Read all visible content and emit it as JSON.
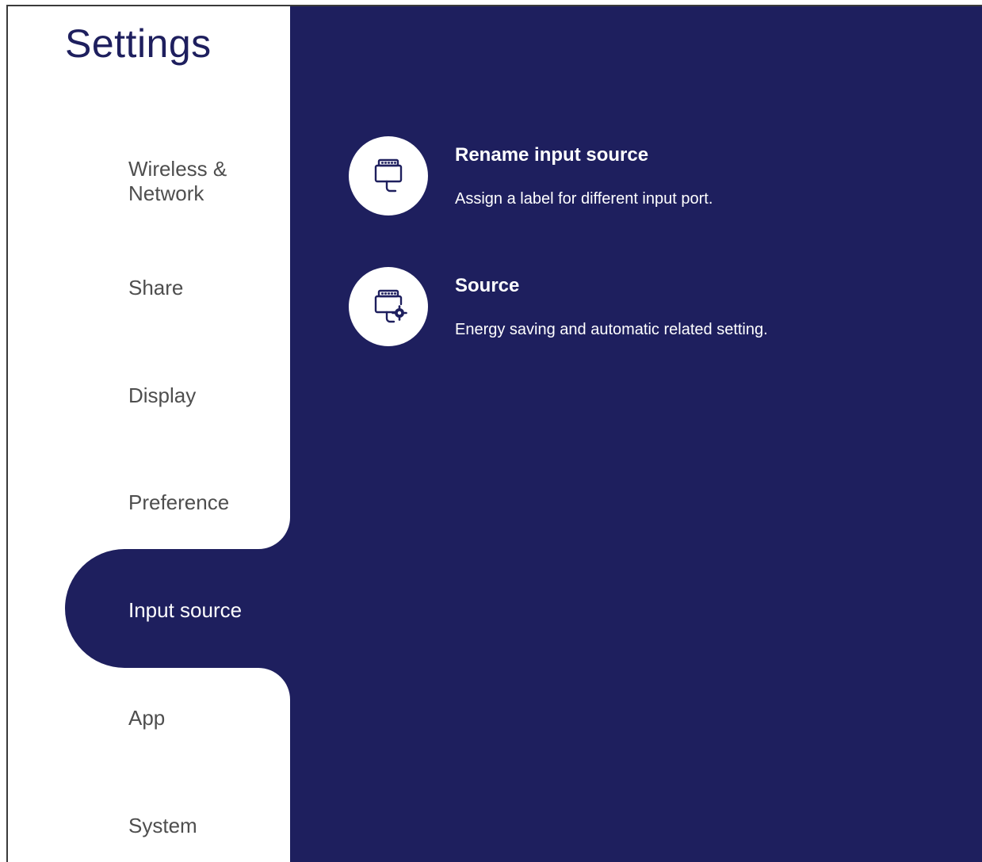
{
  "app": {
    "title": "Settings"
  },
  "colors": {
    "accent": "#1e1f5e",
    "sidebar_text": "#4e4e4e",
    "background": "#ffffff"
  },
  "sidebar": {
    "items": [
      {
        "label": "Wireless &\nNetwork",
        "line1": "Wireless &",
        "line2": "Network",
        "icon": "none"
      },
      {
        "label": "Share"
      },
      {
        "label": "Display"
      },
      {
        "label": "Preference"
      },
      {
        "label": "Input source",
        "selected": true
      },
      {
        "label": "App"
      },
      {
        "label": "System"
      }
    ]
  },
  "main": {
    "options": [
      {
        "title": "Rename input source",
        "description": "Assign a label for different input port.",
        "icon": "input-port-icon"
      },
      {
        "title": "Source",
        "description": "Energy saving and automatic related setting.",
        "icon": "input-port-settings-icon"
      }
    ]
  }
}
